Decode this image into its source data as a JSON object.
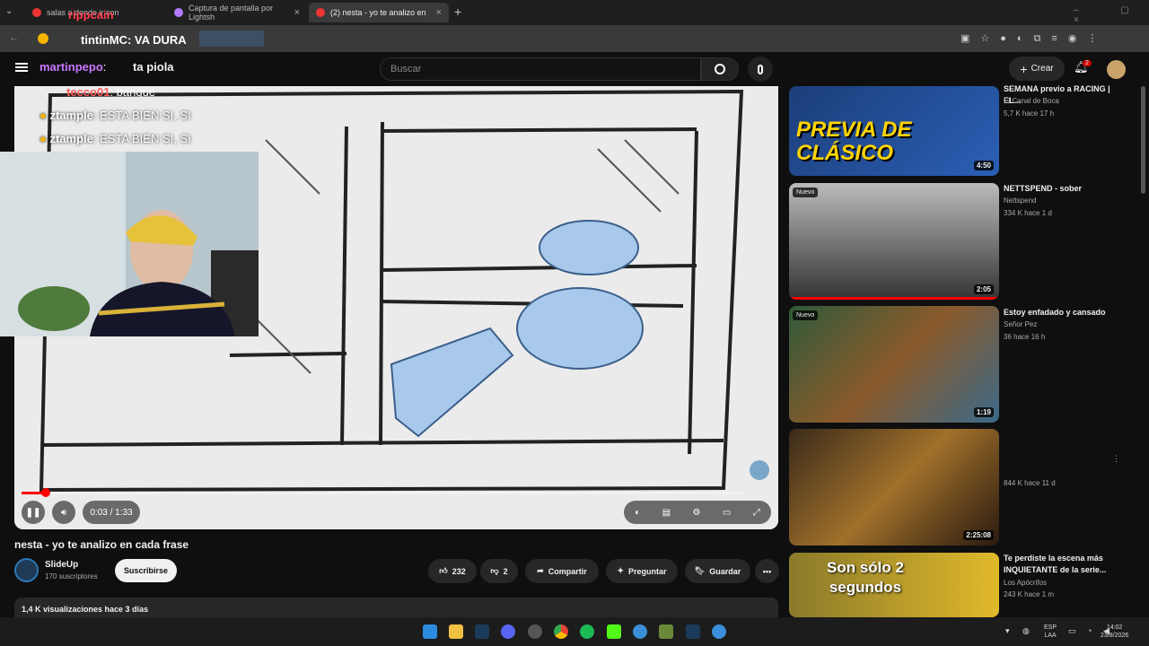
{
  "browser": {
    "tabs": [
      {
        "label": "salas a donde ir con"
      },
      {
        "label": "Captura de pantalla por Lightsh"
      },
      {
        "label": "(2) nesta - yo te analizo en"
      }
    ],
    "address_overlay": "tintinMC: VA DURA"
  },
  "youtube": {
    "search_placeholder": "Buscar",
    "create_label": "Crear",
    "notifications_count": "2"
  },
  "chat_overlay": {
    "lines": [
      {
        "user": "martinpepo",
        "msg": "ta piola",
        "user_color": "#c978ff"
      },
      {
        "user": "tecco01",
        "msg": "banqué",
        "user_color": "#ff5a5a"
      },
      {
        "user": "ztample",
        "msg": "ESTA BIEN SI, SI",
        "user_color": "#ffffff"
      },
      {
        "user": "ztample",
        "msg": "ESTA BIEN SI, SI",
        "user_color": "#ffffff"
      }
    ],
    "top_user": "rippcain"
  },
  "player": {
    "time": "0:03 / 1:33",
    "progress": 0.034
  },
  "video": {
    "title": "nesta - yo te analizo en cada frase",
    "channel": "SlideUp",
    "subscribers": "170 suscriptores",
    "subscribe_label": "Suscribirse",
    "likes": "232",
    "dislikes": "2",
    "share_label": "Compartir",
    "ask_label": "Preguntar",
    "save_label": "Guardar",
    "views_date": "1,4 K visualizaciones  hace 3 días"
  },
  "recommendations": [
    {
      "title": "SEMANA previo a RACING | EL...",
      "channel": "El Canal de Boca",
      "meta": "5,7 K  hace 17 h",
      "duration": "4:50",
      "thumb_text": "PREVIA DE CLÁSICO",
      "nuevo": ""
    },
    {
      "title": "NETTSPEND - sober",
      "channel": "Nettspend",
      "meta": "334 K  hace 1 d",
      "duration": "2:05",
      "nuevo": "Nuevo"
    },
    {
      "title": "Estoy enfadado y cansado",
      "channel": "Señor Pez",
      "meta": "36  hace 16 h",
      "duration": "1:19",
      "nuevo": "Nuevo"
    },
    {
      "title": "",
      "channel": "",
      "meta": "844 K  hace 11 d",
      "duration": "2:25:08",
      "nuevo": ""
    },
    {
      "title": "Te perdiste la escena más INQUIETANTE de la serie...",
      "channel": "Los Apócrifos",
      "meta": "243 K  hace 1 m",
      "duration": "",
      "thumb_text": "Son sólo 2 segundos",
      "nuevo": ""
    }
  ],
  "system": {
    "lang1": "ESP",
    "lang2": "LAA",
    "time": "14:02",
    "date": "23/8/2026"
  }
}
